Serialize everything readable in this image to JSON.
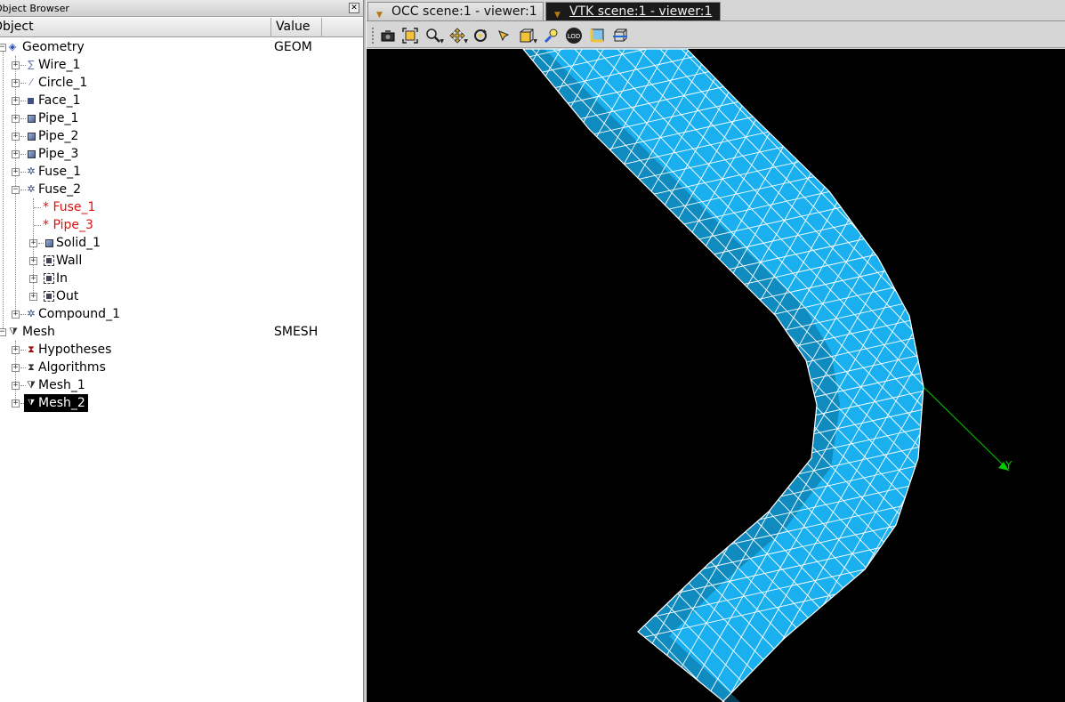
{
  "browser": {
    "title": "Object Browser",
    "close_icon": "close-icon",
    "columns": {
      "object": "Object",
      "value": "Value"
    },
    "geometry": {
      "label": "Geometry",
      "value": "GEOM",
      "items": {
        "wire_1": "Wire_1",
        "circle_1": "Circle_1",
        "face_1": "Face_1",
        "pipe_1": "Pipe_1",
        "pipe_2": "Pipe_2",
        "pipe_3": "Pipe_3",
        "fuse_1": "Fuse_1",
        "fuse_2": "Fuse_2",
        "fuse_2_ref_fuse_1": "* Fuse_1",
        "fuse_2_ref_pipe_3": "* Pipe_3",
        "solid_1": "Solid_1",
        "wall": "Wall",
        "in": "In",
        "out": "Out",
        "compound_1": "Compound_1"
      }
    },
    "mesh": {
      "label": "Mesh",
      "value": "SMESH",
      "items": {
        "hypotheses": "Hypotheses",
        "algorithms": "Algorithms",
        "mesh_1": "Mesh_1",
        "mesh_2": "Mesh_2"
      }
    },
    "selected": "Mesh_2",
    "colors": {
      "reference_text": "#e01010",
      "selection_bg": "#000000"
    }
  },
  "viewer": {
    "tabs": [
      {
        "label": "OCC scene:1 - viewer:1",
        "active": false
      },
      {
        "label": "VTK scene:1 - viewer:1",
        "active": true
      }
    ],
    "toolbar_icons": [
      "camera-icon",
      "fit-all-icon",
      "zoom-icon",
      "pan-icon",
      "rotate-icon",
      "rotation-point-icon",
      "view-cube-icon",
      "light-icon",
      "lod-icon",
      "graduated-axes-icon",
      "clipping-icon"
    ],
    "lod_label": "LOD",
    "axis_label": "Y",
    "colors": {
      "background": "#000000",
      "mesh_fill": "#1ab0f0",
      "mesh_edges": "#ffffff",
      "axis": "#00cc00"
    }
  }
}
